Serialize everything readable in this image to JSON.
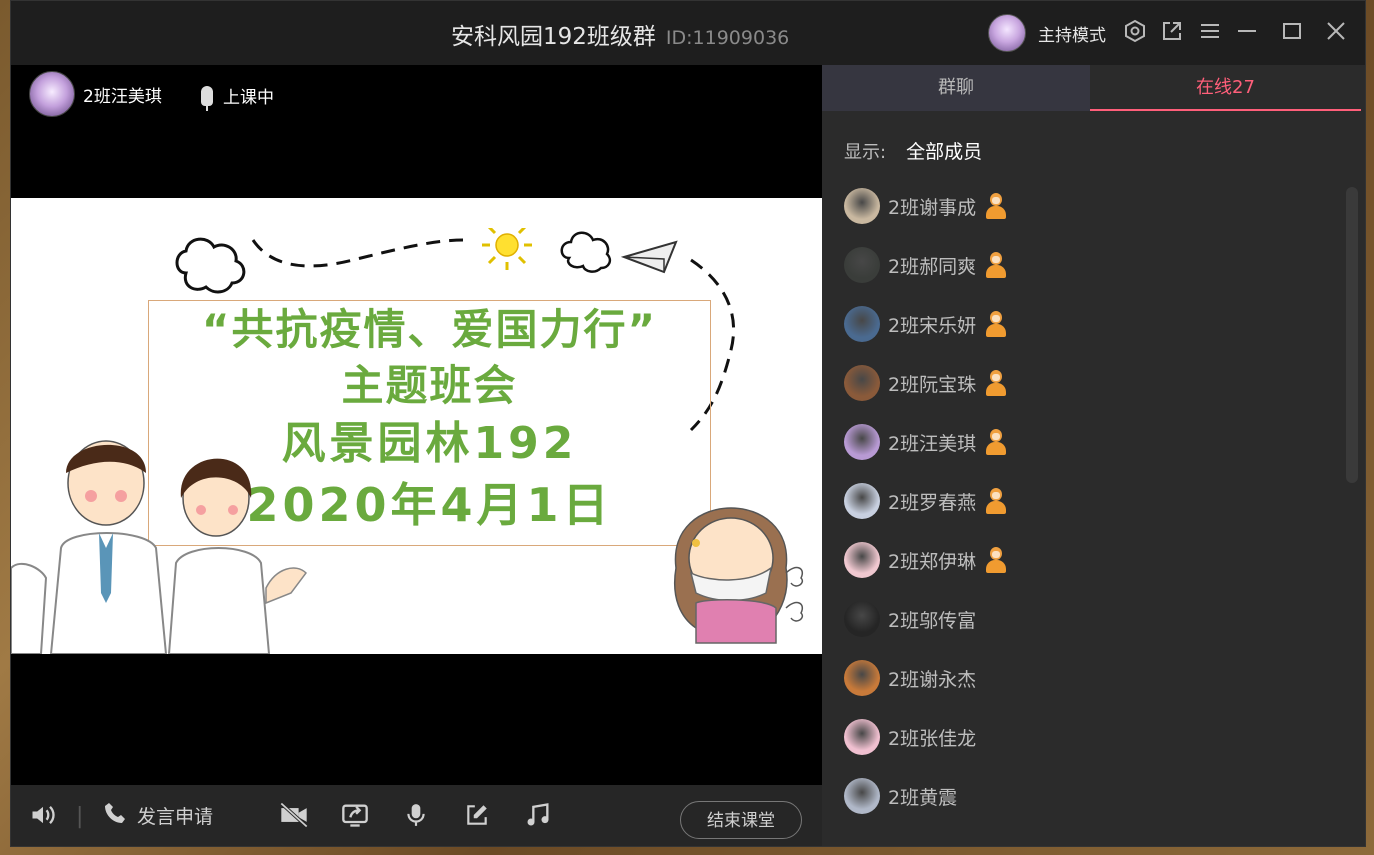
{
  "window": {
    "title": "安科风园192班级群",
    "group_id": "ID:11909036",
    "host_mode_label": "主持模式"
  },
  "video": {
    "teacher_name": "2班汪美琪",
    "status": "上课中",
    "slide": {
      "line1": "“共抗疫情、爱国力行”",
      "line2": "主题班会",
      "line3": "风景园林192",
      "line4": "2020年4月1日"
    }
  },
  "controls": {
    "request_speak": "发言申请",
    "end_class": "结束课堂"
  },
  "panel": {
    "tabs": [
      {
        "label": "群聊"
      },
      {
        "label": "在线27"
      }
    ],
    "filter_label": "显示:",
    "filter_value": "全部成员",
    "members": [
      {
        "name": "2班谢事成",
        "has_badge": true,
        "avatar_color": "#c9b8a0"
      },
      {
        "name": "2班郝同爽",
        "has_badge": true,
        "avatar_color": "#3a3d3a"
      },
      {
        "name": "2班宋乐妍",
        "has_badge": true,
        "avatar_color": "#4a6a90"
      },
      {
        "name": "2班阮宝珠",
        "has_badge": true,
        "avatar_color": "#8a5a3a"
      },
      {
        "name": "2班汪美琪",
        "has_badge": true,
        "avatar_color": "#b89ad4"
      },
      {
        "name": "2班罗春燕",
        "has_badge": true,
        "avatar_color": "#c8d0e0"
      },
      {
        "name": "2班郑伊琳",
        "has_badge": true,
        "avatar_color": "#f0c8d0"
      },
      {
        "name": "2班邬传富",
        "has_badge": false,
        "avatar_color": "#252525"
      },
      {
        "name": "2班谢永杰",
        "has_badge": false,
        "avatar_color": "#c87a3a"
      },
      {
        "name": "2班张佳龙",
        "has_badge": false,
        "avatar_color": "#f0c0d0"
      },
      {
        "name": "2班黄震",
        "has_badge": false,
        "avatar_color": "#b0b8c8"
      }
    ]
  },
  "colors": {
    "accent": "#ff5f7a",
    "slide_text": "#6aaa3e",
    "badge": "#f09b30"
  }
}
